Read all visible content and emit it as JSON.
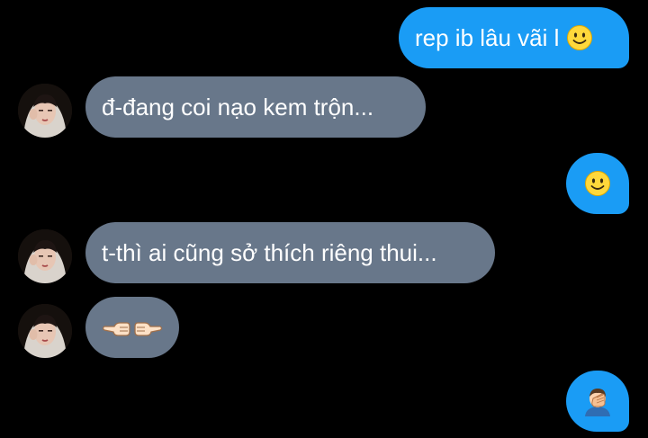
{
  "messages": [
    {
      "side": "out",
      "text": "rep ib lâu vãi l",
      "emoji": "smiling-face"
    },
    {
      "side": "in",
      "text": "đ-đang coi nạo kem trộn..."
    },
    {
      "side": "out",
      "emoji": "smiling-face"
    },
    {
      "side": "in",
      "text": "t-thì ai cũng sở thích riêng thui..."
    },
    {
      "side": "in",
      "emoji": "pointing-left-right-hands"
    },
    {
      "side": "out",
      "emoji": "person-facepalming"
    }
  ],
  "colors": {
    "background": "#000000",
    "outgoing_bubble": "#1a9cf5",
    "incoming_bubble": "#68778a",
    "text": "#ffffff"
  }
}
